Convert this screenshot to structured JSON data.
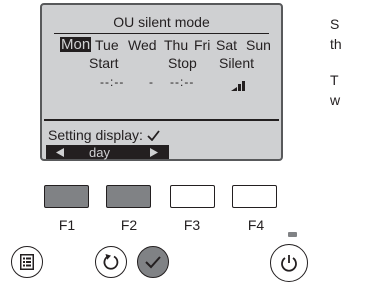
{
  "screen": {
    "title": "OU silent mode",
    "days": [
      "Mon",
      "Tue",
      "Wed",
      "Thu",
      "Fri",
      "Sat",
      "Sun"
    ],
    "selected_day": "Mon",
    "columns": {
      "start": "Start",
      "stop": "Stop",
      "silent": "Silent"
    },
    "start_time": "--:--",
    "separator": "-",
    "stop_time": "--:--",
    "setting_display": "Setting display:",
    "nav_label": "day"
  },
  "function_keys": [
    {
      "label": "F1",
      "state": "active"
    },
    {
      "label": "F2",
      "state": "active"
    },
    {
      "label": "F3",
      "state": "inactive"
    },
    {
      "label": "F4",
      "state": "inactive"
    }
  ],
  "buttons": {
    "menu": "menu-icon",
    "back": "return-icon",
    "confirm": "check-icon",
    "power": "power-icon"
  },
  "side_text": {
    "line1": "S",
    "line2": "th",
    "line3": "T",
    "line4": "w"
  },
  "colors": {
    "lcd_bg": "#cfd0d2",
    "dark": "#231f20",
    "button_gray": "#808285"
  }
}
